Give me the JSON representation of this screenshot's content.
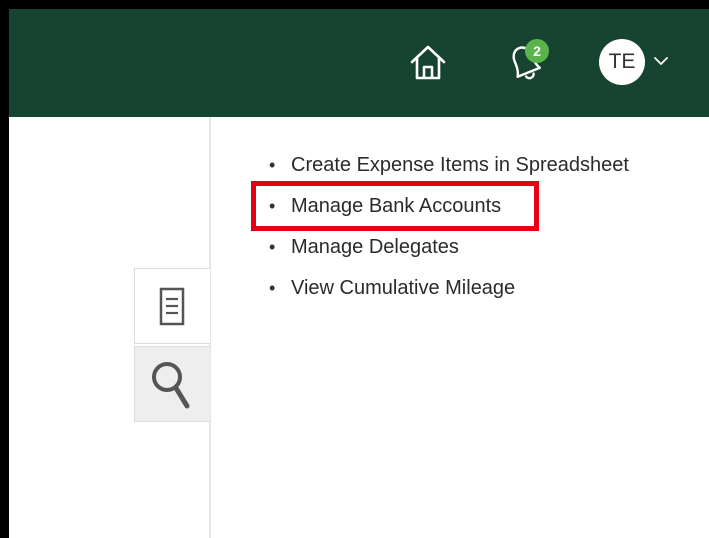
{
  "header": {
    "notification_count": "2",
    "user_initials": "TE",
    "icons": {
      "home": "home-icon",
      "notifications": "bell-icon",
      "menu_caret": "chevron-down-icon"
    },
    "bar_color": "#164431",
    "badge_color": "#5ab44b"
  },
  "sidebar": {
    "tabs": [
      {
        "icon": "document-icon",
        "active": true
      },
      {
        "icon": "search-icon",
        "active": false
      }
    ]
  },
  "tasks": {
    "items": [
      {
        "label": "Create Expense Items in Spreadsheet"
      },
      {
        "label": "Manage Bank Accounts",
        "highlighted": true
      },
      {
        "label": "Manage Delegates"
      },
      {
        "label": "View Cumulative Mileage"
      }
    ],
    "bullet": "•",
    "highlight_color": "#e60012"
  }
}
